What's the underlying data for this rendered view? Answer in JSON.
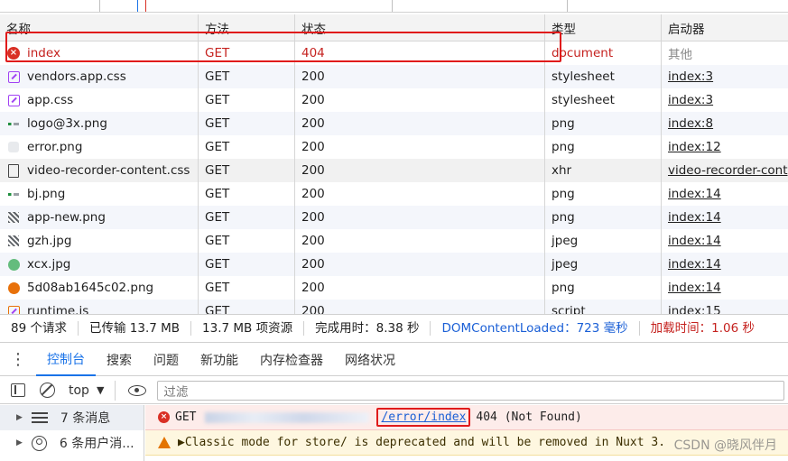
{
  "grid": {
    "headers": {
      "name": "名称",
      "method": "方法",
      "status": "状态",
      "type": "类型",
      "initiator": "启动器"
    },
    "rows": [
      {
        "icon": "error-icon",
        "name": "index",
        "method": "GET",
        "status": "404",
        "type": "document",
        "initiator": "其他",
        "state": "error"
      },
      {
        "icon": "css-icon",
        "name": "vendors.app.css",
        "method": "GET",
        "status": "200",
        "type": "stylesheet",
        "initiator": "index:3"
      },
      {
        "icon": "css-icon",
        "name": "app.css",
        "method": "GET",
        "status": "200",
        "type": "stylesheet",
        "initiator": "index:3"
      },
      {
        "icon": "image-icon",
        "name": "logo@3x.png",
        "method": "GET",
        "status": "200",
        "type": "png",
        "initiator": "index:8"
      },
      {
        "icon": "image-icon",
        "name": "error.png",
        "method": "GET",
        "status": "200",
        "type": "png",
        "initiator": "index:12"
      },
      {
        "icon": "document-icon",
        "name": "video-recorder-content.css",
        "method": "GET",
        "status": "200",
        "type": "xhr",
        "initiator": "video-recorder-cont"
      },
      {
        "icon": "image-icon",
        "name": "bj.png",
        "method": "GET",
        "status": "200",
        "type": "png",
        "initiator": "index:14"
      },
      {
        "icon": "image-icon",
        "name": "app-new.png",
        "method": "GET",
        "status": "200",
        "type": "png",
        "initiator": "index:14"
      },
      {
        "icon": "image-icon",
        "name": "gzh.jpg",
        "method": "GET",
        "status": "200",
        "type": "jpeg",
        "initiator": "index:14"
      },
      {
        "icon": "image-icon",
        "name": "xcx.jpg",
        "method": "GET",
        "status": "200",
        "type": "jpeg",
        "initiator": "index:14"
      },
      {
        "icon": "image-icon",
        "name": "5d08ab1645c02.png",
        "method": "GET",
        "status": "200",
        "type": "png",
        "initiator": "index:14"
      },
      {
        "icon": "script-icon",
        "name": "runtime.js",
        "method": "GET",
        "status": "200",
        "type": "script",
        "initiator": "index:15"
      }
    ]
  },
  "summary": {
    "requests": "89 个请求",
    "transferred": "已传输 13.7 MB",
    "resources": "13.7 MB 项资源",
    "finish": "完成用时：8.38 秒",
    "dom_loaded": "DOMContentLoaded：723 毫秒",
    "load": "加载时间：1.06 秒"
  },
  "drawer": {
    "tabs": [
      "控制台",
      "搜索",
      "问题",
      "新功能",
      "内存检查器",
      "网络状况"
    ],
    "active_tab": "控制台"
  },
  "console": {
    "context": "top",
    "filter_placeholder": "过滤",
    "sidebar": [
      {
        "icon": "list-icon",
        "label": "7 条消息"
      },
      {
        "icon": "user-icon",
        "label": "6 条用户消..."
      }
    ],
    "messages": {
      "error": {
        "method": "GET",
        "url": "/error/index",
        "status": "404 (Not Found)"
      },
      "warning": {
        "text": "▶Classic mode for store/ is deprecated and will be removed in Nuxt 3."
      }
    }
  },
  "watermark": "CSDN @晓风伴月",
  "colors": {
    "error": "#c5221f",
    "accent": "#1a73e8",
    "highlight": "#e01b1b"
  }
}
